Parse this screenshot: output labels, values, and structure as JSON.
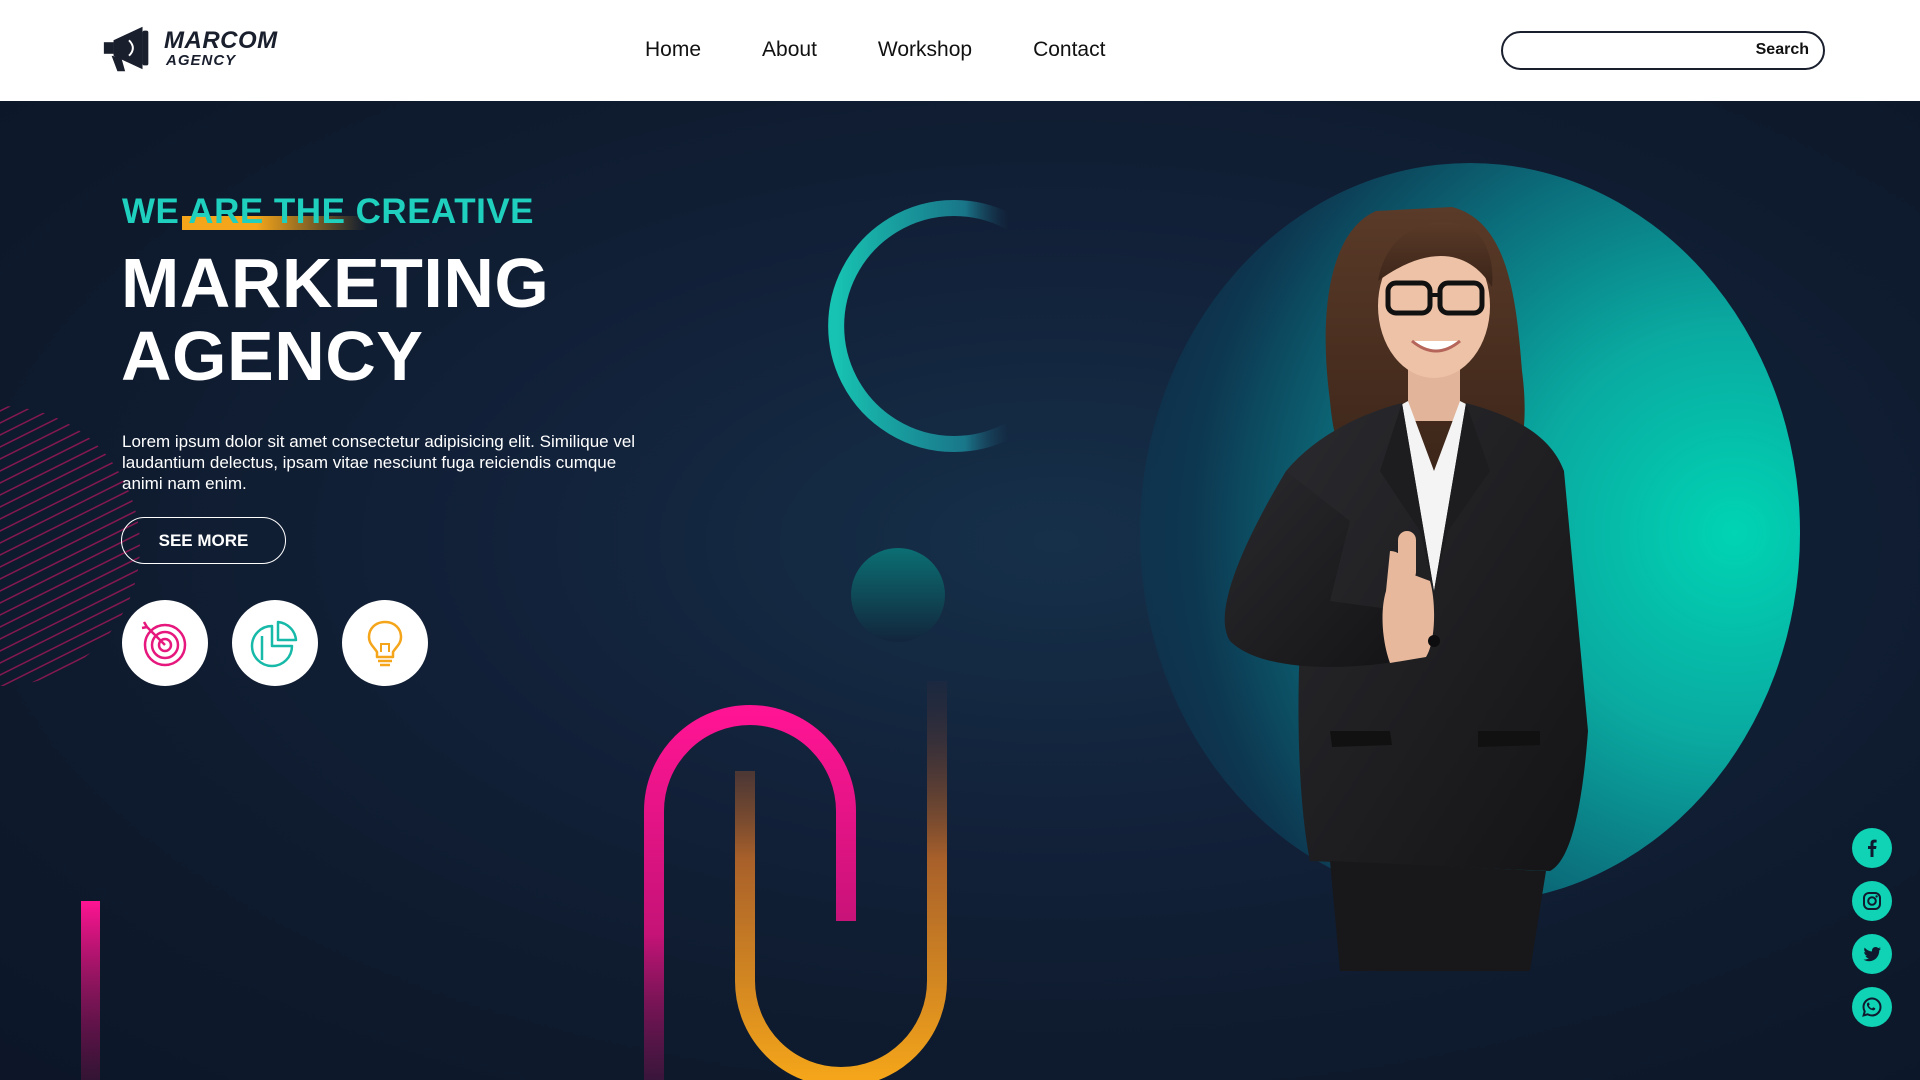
{
  "brand": {
    "name": "MARCOM",
    "sub": "AGENCY"
  },
  "nav": {
    "items": [
      "Home",
      "About",
      "Workshop",
      "Contact"
    ]
  },
  "search": {
    "button_label": "Search",
    "value": "",
    "placeholder": ""
  },
  "hero": {
    "tagline": "WE ARE THE CREATIVE",
    "headline_line1": "MARKETING",
    "headline_line2": "AGENCY",
    "description": "Lorem ipsum dolor sit amet consectetur adipisicing elit. Similique vel laudantium delectus, ipsam vitae nesciunt fuga reiciendis cumque animi nam enim.",
    "cta_label": "SEE MORE"
  },
  "features": [
    {
      "icon": "target-icon",
      "color": "#e6177d"
    },
    {
      "icon": "pie-chart-icon",
      "color": "#17b9a8"
    },
    {
      "icon": "lightbulb-icon",
      "color": "#f4a51a"
    }
  ],
  "social": [
    "facebook-icon",
    "instagram-icon",
    "twitter-icon",
    "whatsapp-icon"
  ],
  "colors": {
    "teal": "#1ed0bd",
    "pink": "#ff1493",
    "orange": "#f4a51a",
    "navy": "#0f1a2e",
    "white": "#ffffff"
  }
}
